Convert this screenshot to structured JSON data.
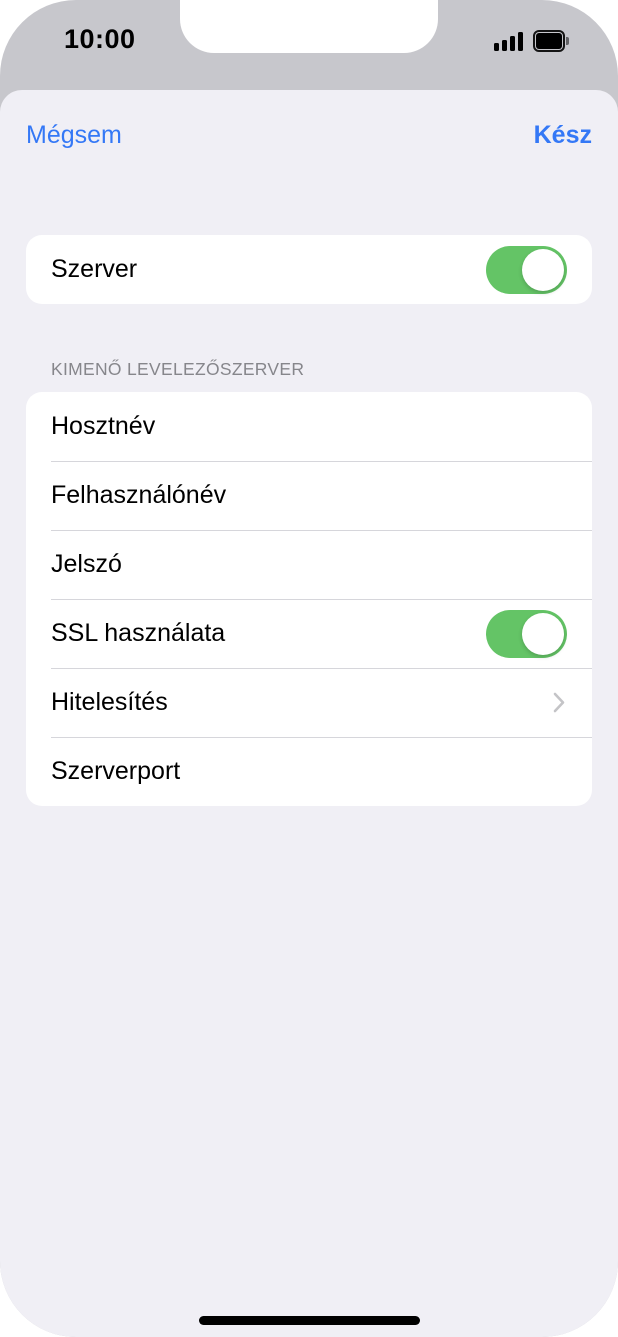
{
  "status_bar": {
    "time": "10:00"
  },
  "nav": {
    "cancel_label": "Mégsem",
    "done_label": "Kész"
  },
  "server_group": {
    "label": "Szerver",
    "enabled": true
  },
  "outgoing_section": {
    "header": "KIMENŐ LEVELEZŐSZERVER",
    "rows": [
      {
        "label": "Hosztnév"
      },
      {
        "label": "Felhasználónév"
      },
      {
        "label": "Jelszó"
      },
      {
        "label": "SSL használata",
        "toggle": true
      },
      {
        "label": "Hitelesítés",
        "chevron": true
      },
      {
        "label": "Szerverport"
      }
    ]
  },
  "colors": {
    "accent": "#3478f6",
    "toggle_on": "#64c466",
    "background": "#f0eff5"
  },
  "icons": [
    "cellular-signal-icon",
    "battery-icon",
    "chevron-right-icon"
  ]
}
